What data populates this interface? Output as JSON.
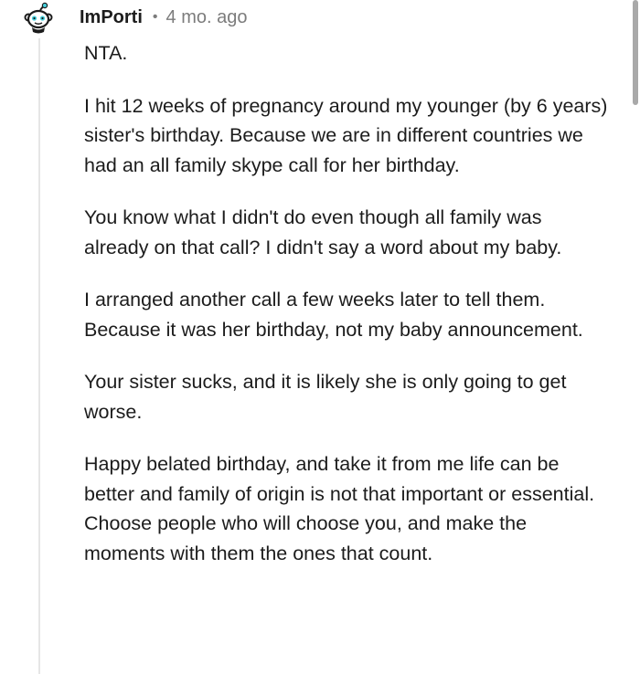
{
  "comment": {
    "username": "ImPorti",
    "separator": "•",
    "timestamp": "4 mo. ago",
    "paragraphs": [
      "NTA.",
      "I hit 12 weeks of pregnancy around my younger (by 6 years) sister's birthday. Because we are in different countries we had an all family skype call for her birthday.",
      "You know what I didn't do even though all family was already on that call? I didn't say a word about my baby.",
      "I arranged another call a few weeks later to tell them. Because it was her birthday, not my baby announcement.",
      "Your sister sucks, and it is likely she is only going to get worse.",
      "Happy belated birthday, and take it from me life can be better and family of origin is not that important or essential. Choose people who will choose you, and make the moments with them the ones that count."
    ]
  },
  "colors": {
    "text": "#1c1c1c",
    "meta": "#7c7c7c",
    "thread_line": "#e6e6e6",
    "avatar_bg": "#46d0dc"
  },
  "icons": {
    "avatar": "snoo-avatar-icon"
  }
}
